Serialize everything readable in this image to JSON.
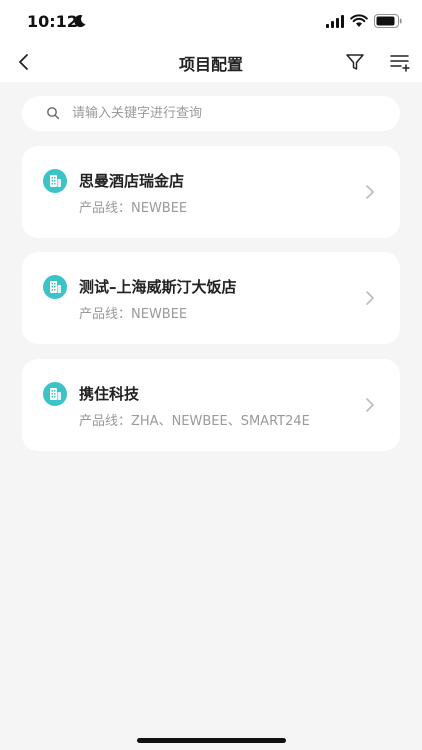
{
  "status": {
    "time": "10:12"
  },
  "header": {
    "title": "项目配置"
  },
  "search": {
    "placeholder": "请输入关键字进行查询",
    "value": ""
  },
  "projects": [
    {
      "name": "思曼酒店瑞金店",
      "product_line": "产品线：NEWBEE"
    },
    {
      "name": "测试–上海威斯汀大饭店",
      "product_line": "产品线：NEWBEE"
    },
    {
      "name": "携住科技",
      "product_line": "产品线：ZHA、NEWBEE、SMART24E"
    }
  ],
  "colors": {
    "accent": "#3cc3c8",
    "background": "#f5f5f5",
    "card": "#ffffff",
    "subtext": "#9a9a9a"
  }
}
